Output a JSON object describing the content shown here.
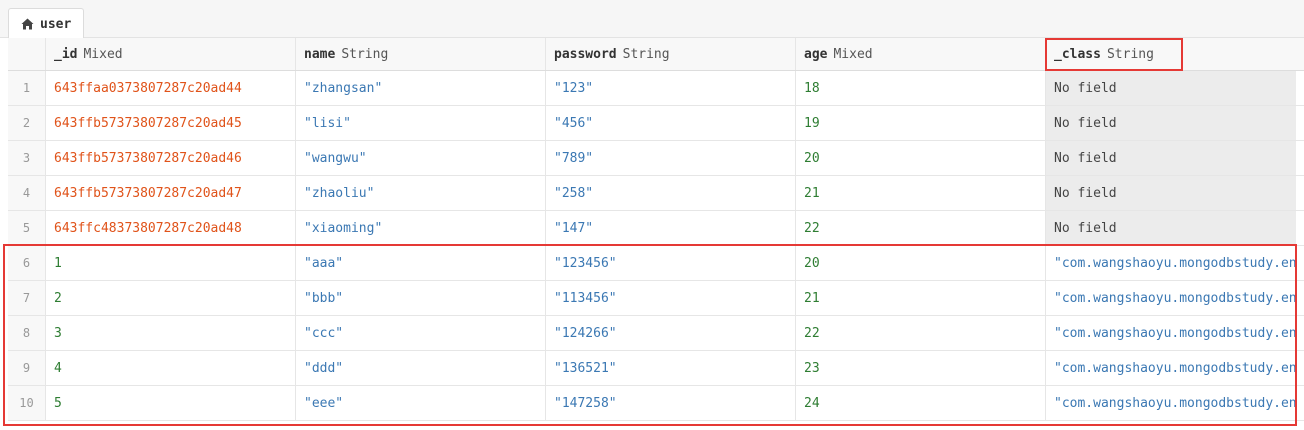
{
  "tab": {
    "label": "user",
    "icon": "home-icon"
  },
  "columns": [
    {
      "name": "_id",
      "type": "Mixed"
    },
    {
      "name": "name",
      "type": "String"
    },
    {
      "name": "password",
      "type": "String"
    },
    {
      "name": "age",
      "type": "Mixed"
    },
    {
      "name": "_class",
      "type": "String"
    }
  ],
  "rows": [
    {
      "num": "1",
      "id": "643ffaa0373807287c20ad44",
      "name": "\"zhangsan\"",
      "password": "\"123\"",
      "age": "18",
      "class": "No field"
    },
    {
      "num": "2",
      "id": "643ffb57373807287c20ad45",
      "name": "\"lisi\"",
      "password": "\"456\"",
      "age": "19",
      "class": "No field"
    },
    {
      "num": "3",
      "id": "643ffb57373807287c20ad46",
      "name": "\"wangwu\"",
      "password": "\"789\"",
      "age": "20",
      "class": "No field"
    },
    {
      "num": "4",
      "id": "643ffb57373807287c20ad47",
      "name": "\"zhaoliu\"",
      "password": "\"258\"",
      "age": "21",
      "class": "No field"
    },
    {
      "num": "5",
      "id": "643ffc48373807287c20ad48",
      "name": "\"xiaoming\"",
      "password": "\"147\"",
      "age": "22",
      "class": "No field"
    },
    {
      "num": "6",
      "id": "1",
      "name": "\"aaa\"",
      "password": "\"123456\"",
      "age": "20",
      "class": "\"com.wangshaoyu.mongodbstudy.en"
    },
    {
      "num": "7",
      "id": "2",
      "name": "\"bbb\"",
      "password": "\"113456\"",
      "age": "21",
      "class": "\"com.wangshaoyu.mongodbstudy.en"
    },
    {
      "num": "8",
      "id": "3",
      "name": "\"ccc\"",
      "password": "\"124266\"",
      "age": "22",
      "class": "\"com.wangshaoyu.mongodbstudy.en"
    },
    {
      "num": "9",
      "id": "4",
      "name": "\"ddd\"",
      "password": "\"136521\"",
      "age": "23",
      "class": "\"com.wangshaoyu.mongodbstudy.en"
    },
    {
      "num": "10",
      "id": "5",
      "name": "\"eee\"",
      "password": "\"147258\"",
      "age": "24",
      "class": "\"com.wangshaoyu.mongodbstudy.en"
    }
  ],
  "colors": {
    "id_value": "#e0531a",
    "string_value": "#3b78b3",
    "number_value": "#2e7d32",
    "highlight": "#e53935"
  }
}
